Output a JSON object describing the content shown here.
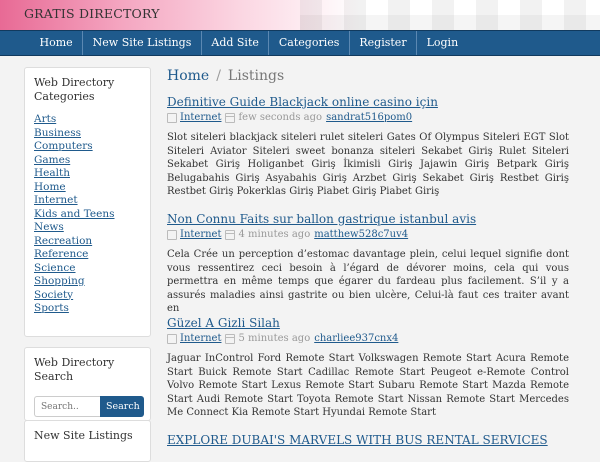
{
  "header": {
    "brand": "GRATIS DIRECTORY"
  },
  "nav": [
    "Home",
    "New Site Listings",
    "Add Site",
    "Categories",
    "Register",
    "Login"
  ],
  "sidebar": {
    "categories_title": "Web Directory Categories",
    "categories": [
      "Arts",
      "Business",
      "Computers",
      "Games",
      "Health",
      "Home",
      "Internet",
      "Kids and Teens",
      "News",
      "Recreation",
      "Reference",
      "Science",
      "Shopping",
      "Society",
      "Sports"
    ],
    "search_title": "Web Directory Search",
    "search_placeholder": "Search..",
    "search_button": "Search",
    "new_listings_title": "New Site Listings"
  },
  "breadcrumb": {
    "home": "Home",
    "separator": "/",
    "current": "Listings"
  },
  "listings": [
    {
      "title": "Definitive Guide Blackjack online casino için",
      "category": "Internet",
      "time": "few seconds ago",
      "user": "sandrat516pom0",
      "description": "Slot siteleri blackjack siteleri rulet siteleri Gates Of Olympus Siteleri EGT Slot Siteleri Aviator Siteleri sweet bonanza siteleri Sekabet Giriş Rulet Siteleri Sekabet Giriş Holiganbet Giriş İkimisli Giriş Jajawin Giriş Betpark Giriş Belugabahis Giriş Asyabahis Giriş Arzbet Giriş Sekabet Giriş Restbet Giriş Restbet Giriş Pokerklas Giriş Piabet Giriş Piabet Giriş"
    },
    {
      "title": "Non Connu Faits sur ballon gastrique istanbul avis",
      "category": "Internet",
      "time": "4 minutes ago",
      "user": "matthew528c7uv4",
      "description": "Cela Crée un perception d’estomac davantage plein, celui lequel signifie dont vous ressentirez ceci besoin à l’égard de dévorer moins, cela qui vous permettra en même temps que égarer du fardeau plus facilement. S’il y a assurés maladies ainsi gastrite ou bien ulcère, Celui-là faut ces traiter avant en"
    },
    {
      "title": "Güzel A Gizli Silah",
      "category": "Internet",
      "time": "5 minutes ago",
      "user": "charliee937cnx4",
      "description": "Jaguar InControl Ford Remote Start Volkswagen Remote Start Acura Remote Start Buick Remote Start Cadillac Remote Start Peugeot e-Remote Control Volvo Remote Start Lexus Remote Start Subaru Remote Start Mazda Remote Start Audi Remote Start Toyota Remote Start Nissan Remote Start Mercedes Me Connect Kia Remote Start Hyundai Remote Start"
    },
    {
      "title": "EXPLORE DUBAI'S MARVELS WITH BUS RENTAL SERVICES",
      "category": "",
      "time": "",
      "user": "",
      "description": ""
    }
  ]
}
